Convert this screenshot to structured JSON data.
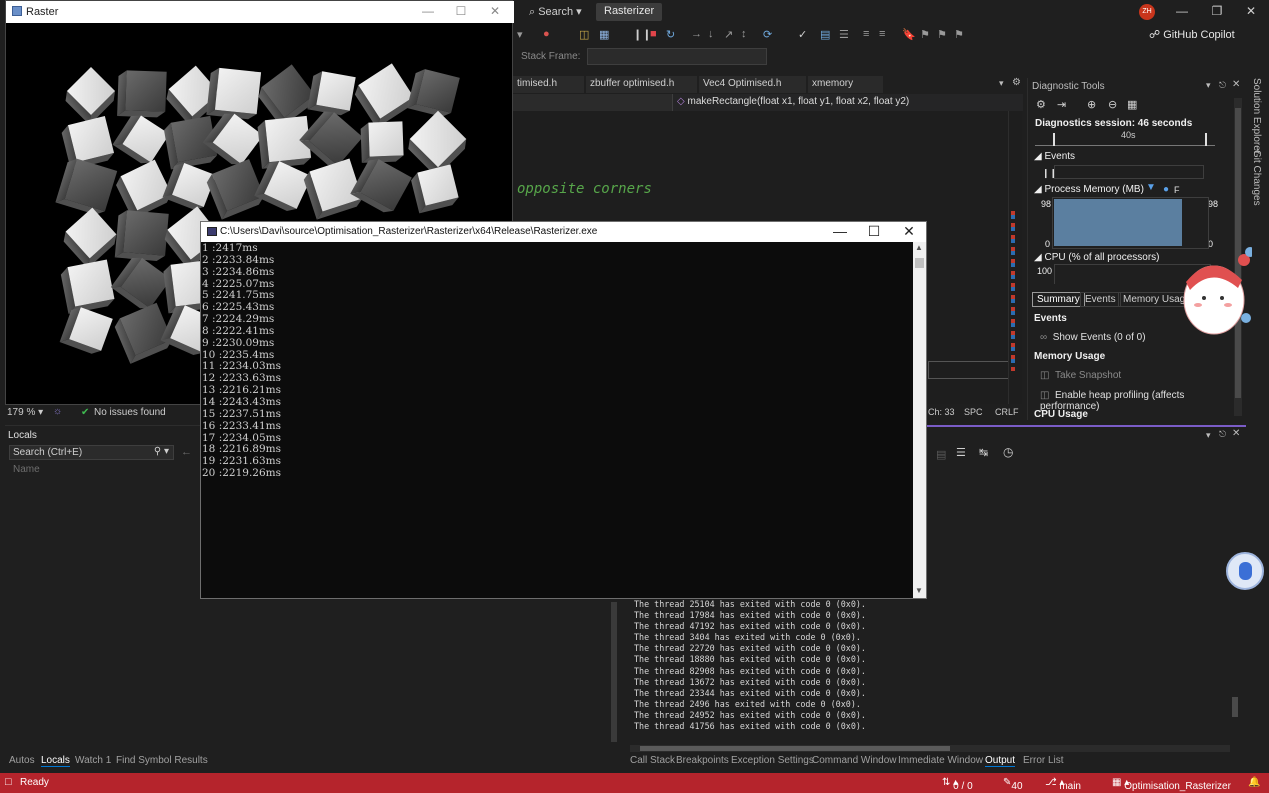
{
  "vs": {
    "search_label": "Search",
    "project_badge": "Rasterizer",
    "avatar_initials": "ZH",
    "copilot_label": "GitHub Copilot",
    "stack_frame_label": "Stack Frame:",
    "tabs": [
      "timised.h",
      "zbuffer optimised.h",
      "Vec4 Optimised.h",
      "xmemory"
    ],
    "nav_member": "makeRectangle(float x1, float y1, float x2, float y2)",
    "editor_comment": "opposite corners",
    "status_strip": {
      "ch": "Ch: 33",
      "spc": "SPC",
      "crlf": "CRLF"
    }
  },
  "diagnostics": {
    "title": "Diagnostic Tools",
    "session": "Diagnostics session: 46 seconds",
    "timeline_label": "40s",
    "events_header": "Events",
    "process_memory_header": "Process Memory (MB)",
    "memory_legend": "F",
    "mem_max_left": "98",
    "mem_min_left": "0",
    "mem_max_right": "98",
    "mem_min_right": "0",
    "cpu_header": "CPU (% of all processors)",
    "cpu_max": "100",
    "tabs": [
      "Summary",
      "Events",
      "Memory Usage"
    ],
    "events_section": "Events",
    "show_events": "Show Events (0 of 0)",
    "memory_usage_section": "Memory Usage",
    "take_snapshot": "Take Snapshot",
    "heap_profiling": "Enable heap profiling (affects performance)",
    "cpu_usage_section": "CPU Usage"
  },
  "right_rail": {
    "solution_explorer": "Solution Explorer",
    "git_changes": "Git Changes"
  },
  "raster_window": {
    "title": "Raster"
  },
  "left_status": {
    "zoom": "179 %",
    "issues": "No issues found"
  },
  "locals": {
    "title": "Locals",
    "search_placeholder": "Search (Ctrl+E)",
    "name_column": "Name"
  },
  "bottom_tabs_left": [
    "Autos",
    "Locals",
    "Watch 1",
    "Find Symbol Results"
  ],
  "bottom_tabs_right": [
    "Call Stack",
    "Breakpoints",
    "Exception Settings",
    "Command Window",
    "Immediate Window",
    "Output",
    "Error List"
  ],
  "output_lines": [
    "The thread 25104 has exited with code 0 (0x0).",
    "The thread 17984 has exited with code 0 (0x0).",
    "The thread 47192 has exited with code 0 (0x0).",
    "The thread 3404 has exited with code 0 (0x0).",
    "The thread 22720 has exited with code 0 (0x0).",
    "The thread 18880 has exited with code 0 (0x0).",
    "The thread 82908 has exited with code 0 (0x0).",
    "The thread 13672 has exited with code 0 (0x0).",
    "The thread 23344 has exited with code 0 (0x0).",
    "The thread 2496 has exited with code 0 (0x0).",
    "The thread 24952 has exited with code 0 (0x0).",
    "The thread 41756 has exited with code 0 (0x0)."
  ],
  "console": {
    "title": "C:\\Users\\Davi\\source\\Optimisation_Rasterizer\\Rasterizer\\x64\\Release\\Rasterizer.exe",
    "lines": [
      "1 :2417ms",
      "2 :2233.84ms",
      "3 :2234.86ms",
      "4 :2225.07ms",
      "5 :2241.75ms",
      "6 :2225.43ms",
      "7 :2224.29ms",
      "8 :2222.41ms",
      "9 :2230.09ms",
      "10 :2235.4ms",
      "11 :2234.03ms",
      "12 :2233.63ms",
      "13 :2216.21ms",
      "14 :2243.43ms",
      "15 :2237.51ms",
      "16 :2233.41ms",
      "17 :2234.05ms",
      "18 :2216.89ms",
      "19 :2231.63ms",
      "20 :2219.26ms"
    ]
  },
  "statusbar": {
    "ready": "Ready",
    "arrows": "0 / 0",
    "edits": "40",
    "branch": "main",
    "solution": "Optimisation_Rasterizer"
  },
  "colors": {
    "statusbar": "#b5242c",
    "accent": "#0078d4",
    "cube": "#c9c9c9"
  }
}
